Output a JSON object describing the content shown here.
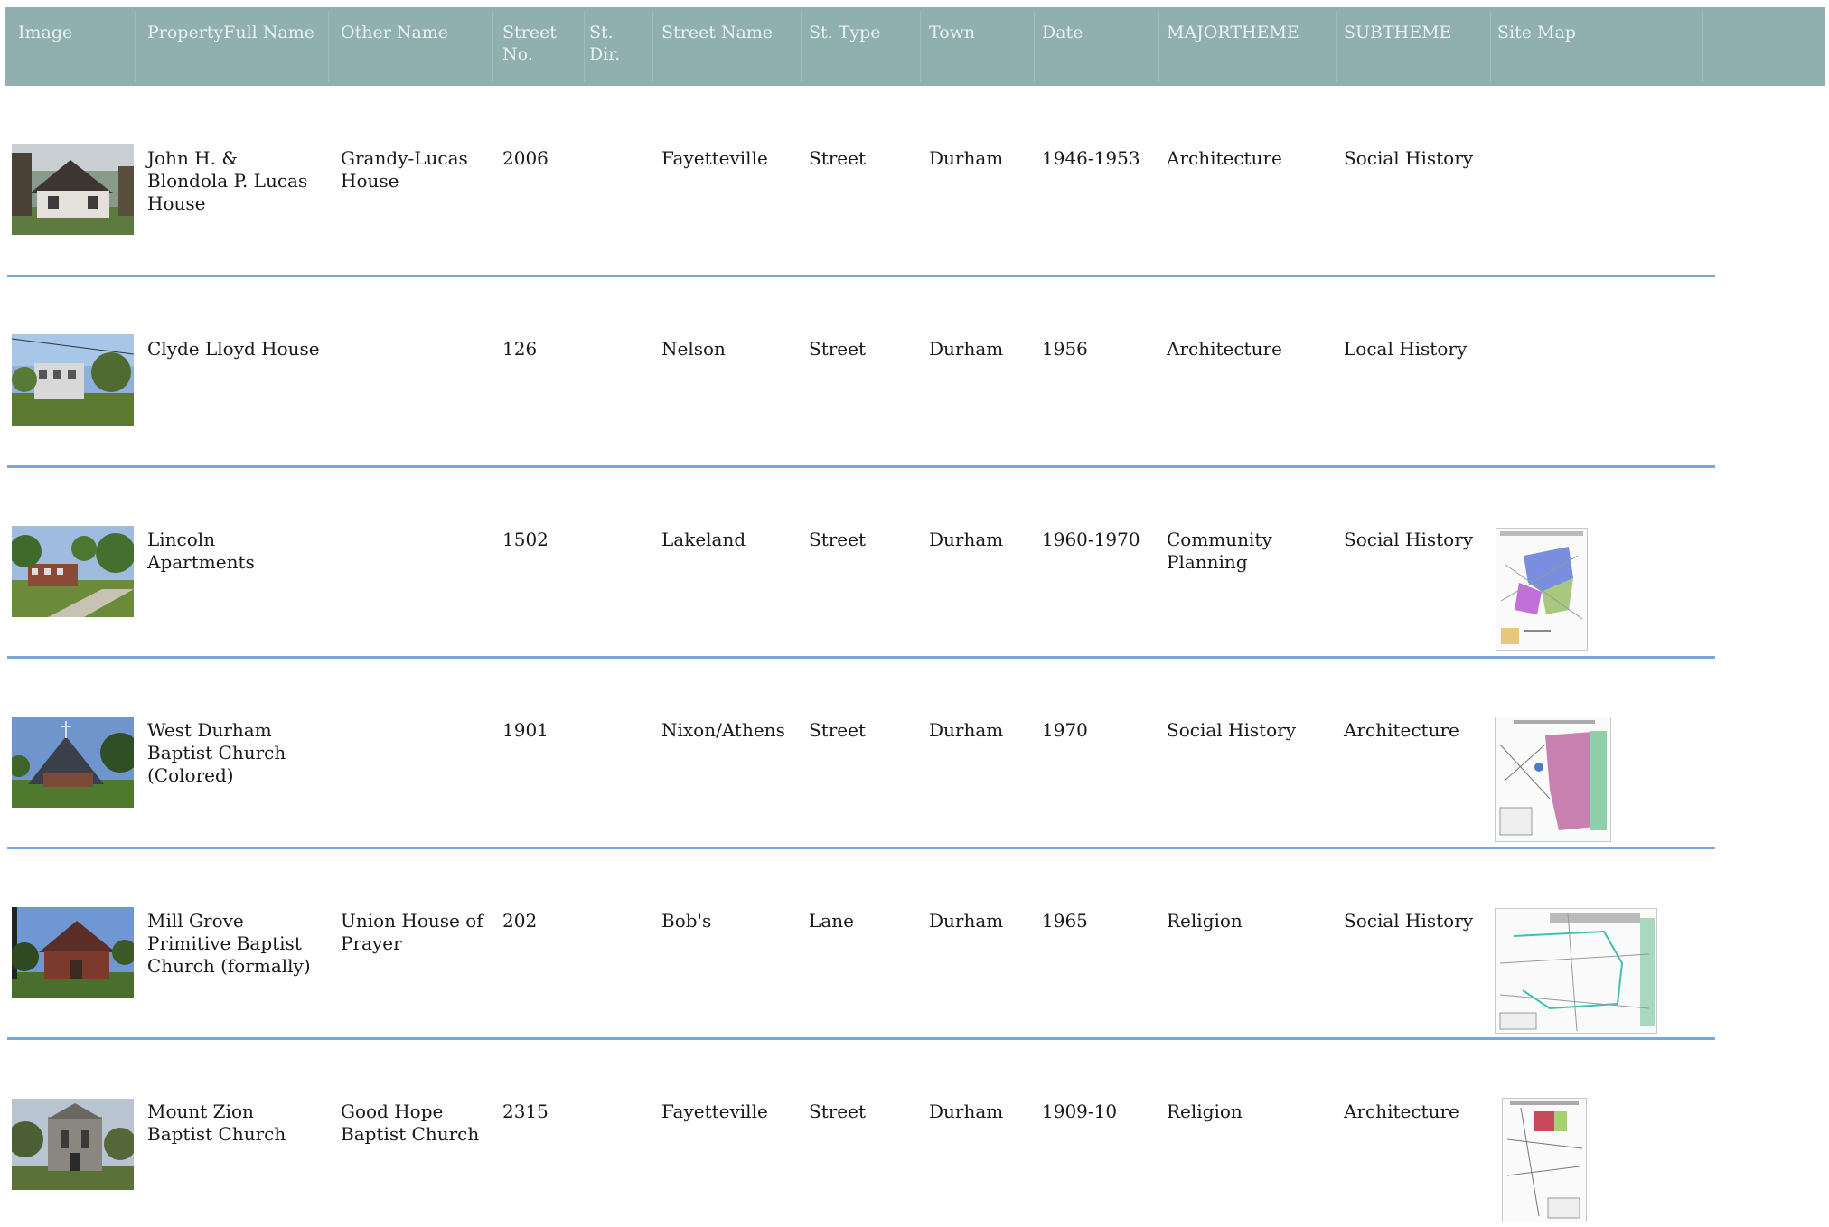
{
  "columns": {
    "image": "Image",
    "property_full_name": "PropertyFull Name",
    "other_name": "Other Name",
    "street_no": "StreetNo.",
    "st_dir": "St. Dir.",
    "street_name": "Street Name",
    "st_type": "St. Type",
    "town": "Town",
    "date": "Date",
    "majortheme": "MAJORTHEME",
    "subtheme": "SUBTHEME",
    "site_map": "Site Map"
  },
  "rows": [
    {
      "name": "John H. & Blondola P. Lucas House",
      "other_name": "Grandy-Lucas House",
      "street_no": "2006",
      "st_dir": "",
      "street_name": "Fayetteville",
      "st_type": "Street",
      "town": "Durham",
      "date": "1946-1953",
      "majortheme": "Architecture",
      "subtheme": "Social History",
      "has_site_map": false,
      "photo_subject": "house-photo"
    },
    {
      "name": "Clyde Lloyd House",
      "other_name": "",
      "street_no": "126",
      "st_dir": "",
      "street_name": "Nelson",
      "st_type": "Street",
      "town": "Durham",
      "date": "1956",
      "majortheme": "Architecture",
      "subtheme": "Local History",
      "has_site_map": false,
      "photo_subject": "house-photo"
    },
    {
      "name": "Lincoln Apartments",
      "other_name": "",
      "street_no": "1502",
      "st_dir": "",
      "street_name": "Lakeland",
      "st_type": "Street",
      "town": "Durham",
      "date": "1960-1970",
      "majortheme": "Community Planning",
      "subtheme": "Social History",
      "has_site_map": true,
      "photo_subject": "apartments-photo"
    },
    {
      "name": "West Durham Baptist Church (Colored)",
      "other_name": "",
      "street_no": "1901",
      "st_dir": "",
      "street_name": "Nixon/Athens",
      "st_type": "Street",
      "town": "Durham",
      "date": "1970",
      "majortheme": "Social History",
      "subtheme": "Architecture",
      "has_site_map": true,
      "photo_subject": "church-photo"
    },
    {
      "name": "Mill Grove Primitive Baptist Church (formally)",
      "other_name": "Union House of Prayer",
      "street_no": "202",
      "st_dir": "",
      "street_name": "Bob's",
      "st_type": "Lane",
      "town": "Durham",
      "date": "1965",
      "majortheme": "Religion",
      "subtheme": "Social History",
      "has_site_map": true,
      "photo_subject": "church-photo"
    },
    {
      "name": "Mount Zion Baptist Church",
      "other_name": "Good Hope Baptist Church",
      "street_no": "2315",
      "st_dir": "",
      "street_name": "Fayetteville",
      "st_type": "Street",
      "town": "Durham",
      "date": "1909-10",
      "majortheme": "Religion",
      "subtheme": "Architecture",
      "has_site_map": true,
      "photo_subject": "church-photo"
    }
  ],
  "colors": {
    "header_bg": "#8fb0ae",
    "header_text": "#e9f1f0",
    "row_rule": "#7aa8d6"
  }
}
